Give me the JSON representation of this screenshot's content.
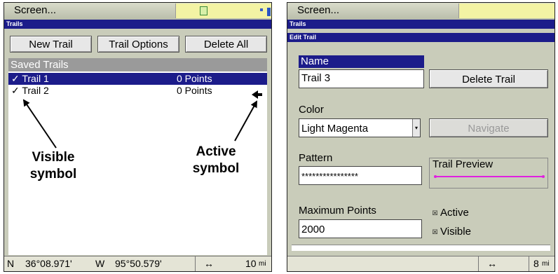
{
  "left": {
    "title": "Screen...",
    "dialog_title": "Trails",
    "buttons": {
      "new_trail": "New Trail",
      "trail_options": "Trail Options",
      "delete_all": "Delete All"
    },
    "saved_header": "Saved Trails",
    "trails": [
      {
        "name": "✓ Trail 1",
        "points": "0 Points"
      },
      {
        "name": "✓ Trail 2",
        "points": "0 Points"
      }
    ],
    "annotations": {
      "visible": "Visible symbol",
      "active": "Active symbol"
    },
    "status": {
      "lat_prefix": "N",
      "lat": "36°08.971'",
      "lon_prefix": "W",
      "lon": "95°50.579'",
      "arrow": "↔",
      "scale": "10",
      "unit": "mi"
    }
  },
  "right": {
    "title": "Screen...",
    "dialog_title": "Trails",
    "edit_title": "Edit Trail",
    "name_label": "Name",
    "name_value": "Trail 3",
    "delete_button": "Delete Trail",
    "color_label": "Color",
    "color_value": "Light Magenta",
    "navigate_button": "Navigate",
    "pattern_label": "Pattern",
    "pattern_value": "****************",
    "preview_label": "Trail Preview",
    "max_label": "Maximum Points",
    "max_value": "2000",
    "active_label": "Active",
    "visible_label": "Visible",
    "status": {
      "arrow": "↔",
      "scale": "8",
      "unit": "mi"
    }
  },
  "colors": {
    "title_bar": "#1c1c8a",
    "screen_bg": "#c9ccba",
    "trail_preview": "#e020e0"
  }
}
